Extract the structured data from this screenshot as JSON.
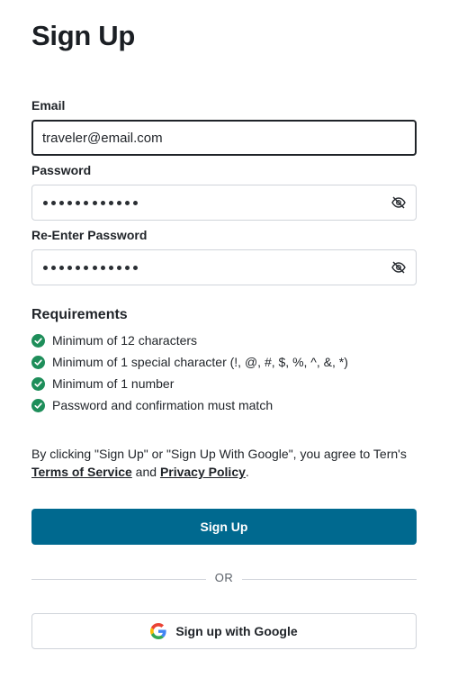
{
  "page": {
    "title": "Sign Up"
  },
  "form": {
    "email": {
      "label": "Email",
      "value": "traveler@email.com"
    },
    "password": {
      "label": "Password",
      "masked_length": 12,
      "visibility_icon": "eye-off-icon"
    },
    "confirm_password": {
      "label": "Re-Enter Password",
      "masked_length": 12,
      "visibility_icon": "eye-off-icon"
    }
  },
  "requirements": {
    "title": "Requirements",
    "items": [
      {
        "text": "Minimum of 12 characters",
        "met": true
      },
      {
        "text": "Minimum of 1 special character (!, @, #, $, %, ^, &, *)",
        "met": true
      },
      {
        "text": "Minimum of 1 number",
        "met": true
      },
      {
        "text": "Password and confirmation must match",
        "met": true
      }
    ]
  },
  "consent": {
    "prefix": "By clicking \"Sign Up\" or \"Sign Up With Google\", you agree to Tern's ",
    "terms_label": "Terms of Service",
    "joiner": " and ",
    "privacy_label": "Privacy Policy",
    "suffix": "."
  },
  "buttons": {
    "sign_up_label": "Sign Up",
    "divider_label": "OR",
    "google_label": "Sign up with Google"
  },
  "colors": {
    "primary": "#00698f",
    "success": "#1e8e5a",
    "border": "#d0d4da",
    "text": "#1f2328"
  }
}
